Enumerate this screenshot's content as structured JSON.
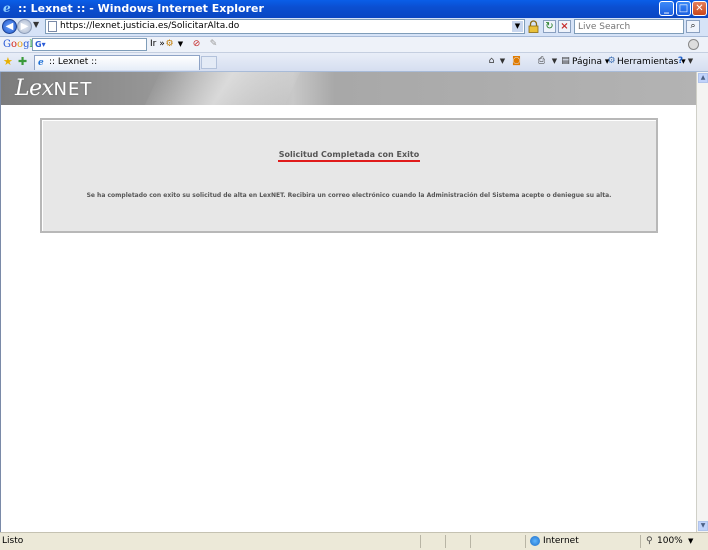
{
  "window": {
    "title": ":: Lexnet :: - Windows Internet Explorer",
    "minimize_glyph": "_",
    "maximize_glyph": "□",
    "close_glyph": "✕"
  },
  "address_bar": {
    "url": "https://lexnet.justicia.es/SolicitarAlta.do",
    "search_placeholder": "Live Search"
  },
  "google_toolbar": {
    "brand": [
      "G",
      "o",
      "o",
      "g",
      "l",
      "e"
    ],
    "search_value": "G▾",
    "go_label": "Ir"
  },
  "tabs": [
    {
      "label": ":: Lexnet ::"
    }
  ],
  "command_bar": {
    "page_label": "Página",
    "tools_label": "Herramientas"
  },
  "banner": {
    "logo_lex": "Lex",
    "logo_net": "NET"
  },
  "message": {
    "title": "Solicitud Completada con Exito",
    "body": "Se ha completado con exito su solicitud de alta en LexNET. Recibira un correo electrónico cuando la Administración del Sistema acepte o deniegue su alta."
  },
  "status_bar": {
    "status": "Listo",
    "zone": "Internet",
    "zoom": "100%"
  }
}
